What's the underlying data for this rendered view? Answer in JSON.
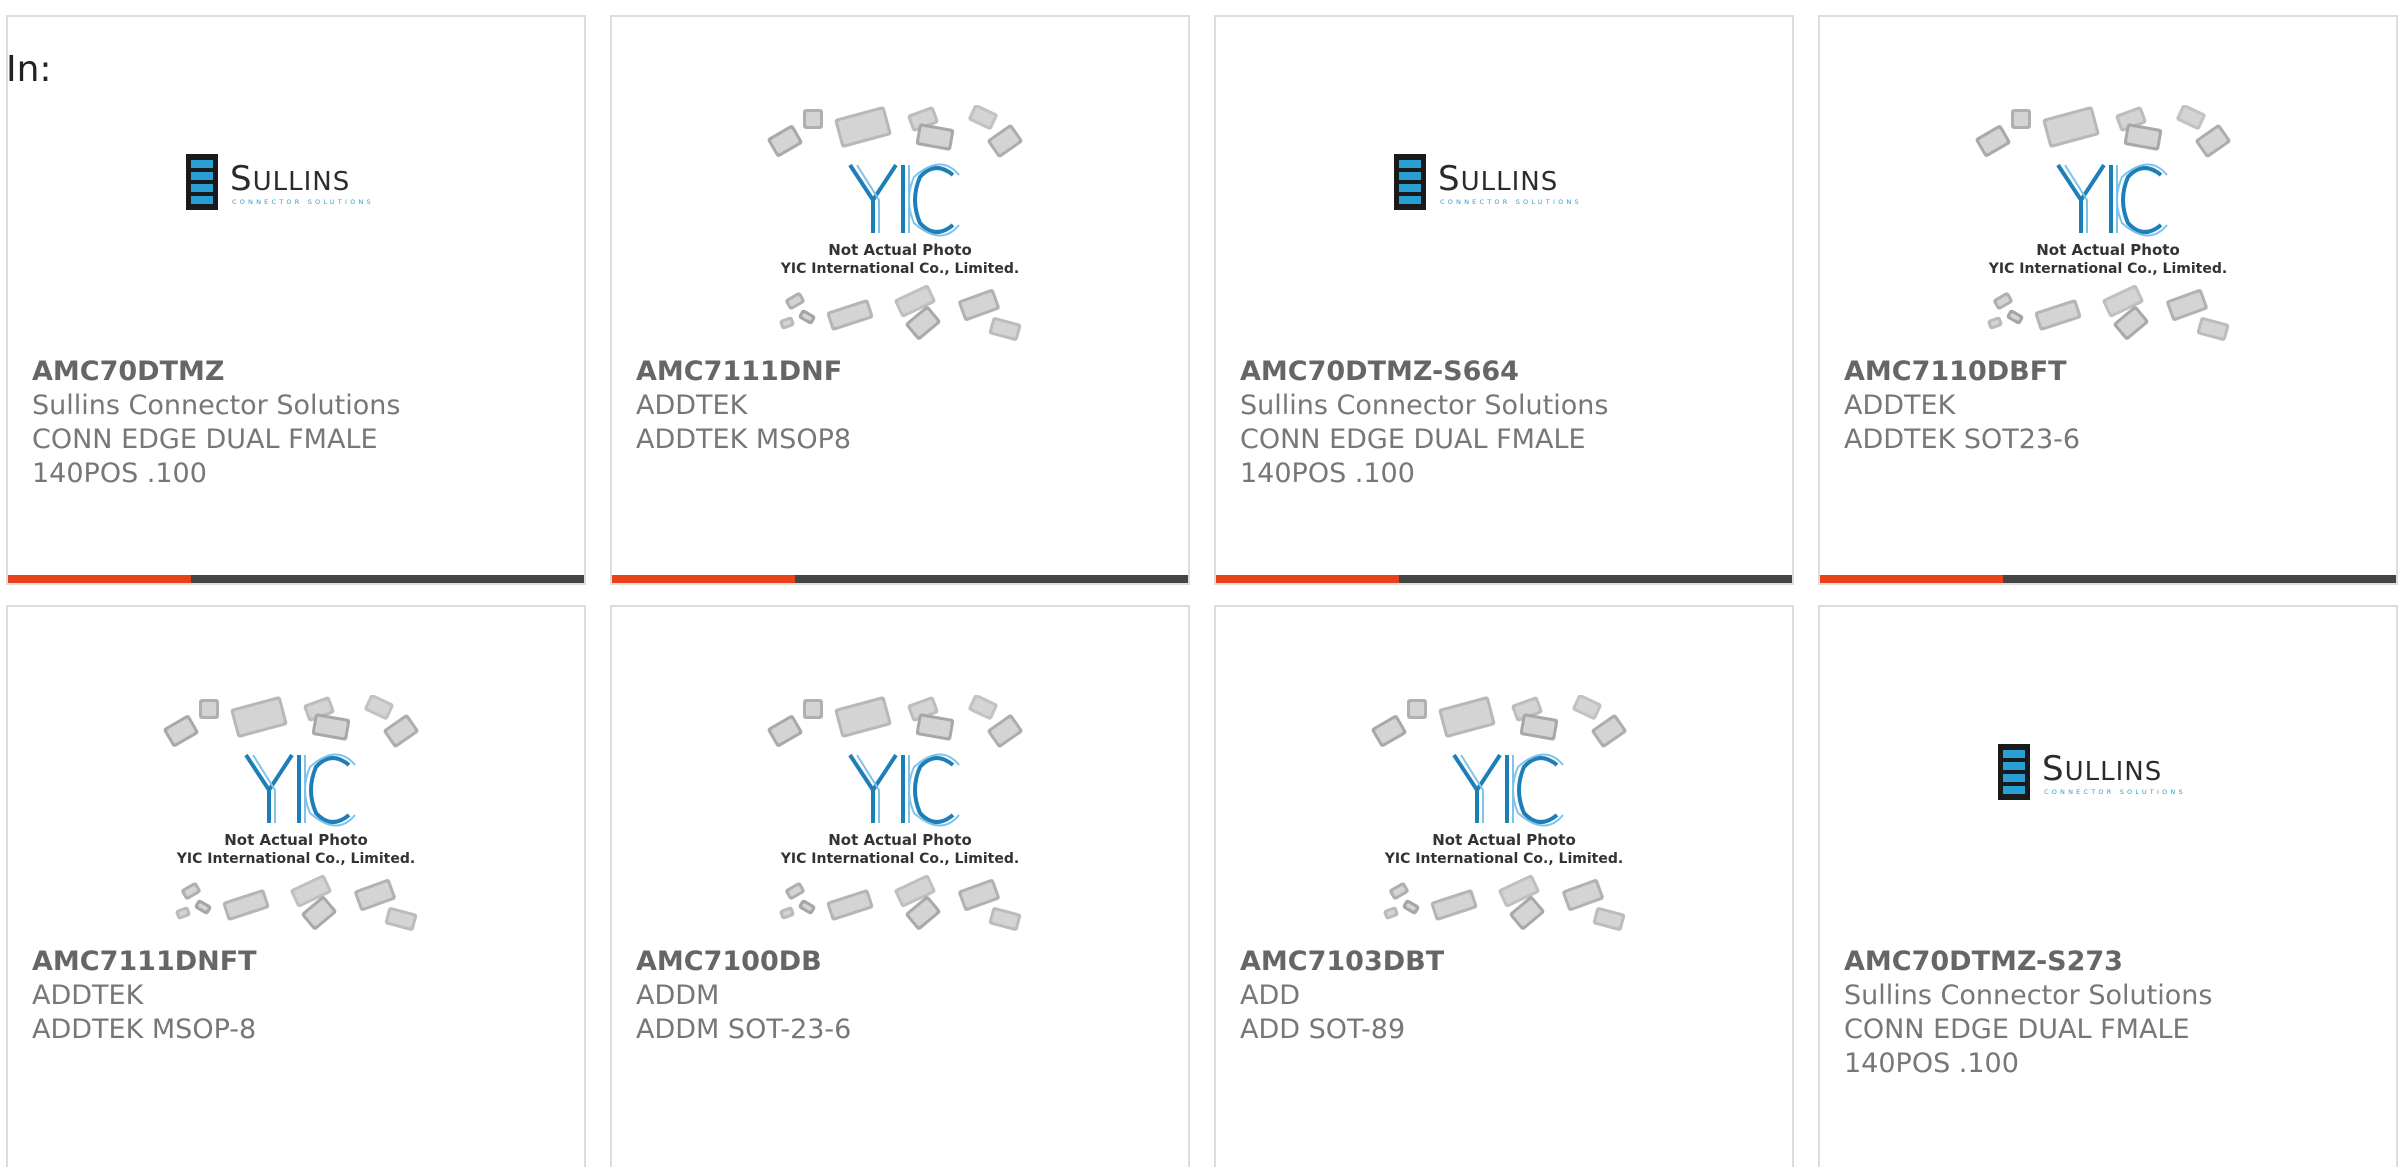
{
  "header": {
    "label": "In:"
  },
  "colors": {
    "accent": "#e8421a",
    "bar": "#444444",
    "brand_blue": "#1e7fb8"
  },
  "products": [
    {
      "part_number": "AMC70DTMZ",
      "manufacturer": "Sullins Connector Solutions",
      "description_line1": "CONN EDGE DUAL FMALE",
      "description_line2": "140POS .100",
      "image": "sullins-logo",
      "logo_text": "SULLINS",
      "logo_sub": "CONNECTOR SOLUTIONS"
    },
    {
      "part_number": "AMC7111DNF",
      "manufacturer": "ADDTEK",
      "description_line1": "ADDTEK MSOP8",
      "description_line2": "",
      "image": "yic-placeholder",
      "photo_note1": "Not Actual Photo",
      "photo_note2": "YIC International Co., Limited."
    },
    {
      "part_number": "AMC70DTMZ-S664",
      "manufacturer": "Sullins Connector Solutions",
      "description_line1": "CONN EDGE DUAL FMALE",
      "description_line2": "140POS .100",
      "image": "sullins-logo",
      "logo_text": "SULLINS",
      "logo_sub": "CONNECTOR SOLUTIONS"
    },
    {
      "part_number": "AMC7110DBFT",
      "manufacturer": "ADDTEK",
      "description_line1": "ADDTEK SOT23-6",
      "description_line2": "",
      "image": "yic-placeholder",
      "photo_note1": "Not Actual Photo",
      "photo_note2": "YIC International Co., Limited."
    },
    {
      "part_number": "AMC7111DNFT",
      "manufacturer": "ADDTEK",
      "description_line1": "ADDTEK MSOP-8",
      "description_line2": "",
      "image": "yic-placeholder",
      "photo_note1": "Not Actual Photo",
      "photo_note2": "YIC International Co., Limited."
    },
    {
      "part_number": "AMC7100DB",
      "manufacturer": "ADDM",
      "description_line1": "ADDM SOT-23-6",
      "description_line2": "",
      "image": "yic-placeholder",
      "photo_note1": "Not Actual Photo",
      "photo_note2": "YIC International Co., Limited."
    },
    {
      "part_number": "AMC7103DBT",
      "manufacturer": "ADD",
      "description_line1": "ADD SOT-89",
      "description_line2": "",
      "image": "yic-placeholder",
      "photo_note1": "Not Actual Photo",
      "photo_note2": "YIC International Co., Limited."
    },
    {
      "part_number": "AMC70DTMZ-S273",
      "manufacturer": "Sullins Connector Solutions",
      "description_line1": "CONN EDGE DUAL FMALE",
      "description_line2": "140POS .100",
      "image": "sullins-logo",
      "logo_text": "SULLINS",
      "logo_sub": "CONNECTOR SOLUTIONS"
    }
  ]
}
